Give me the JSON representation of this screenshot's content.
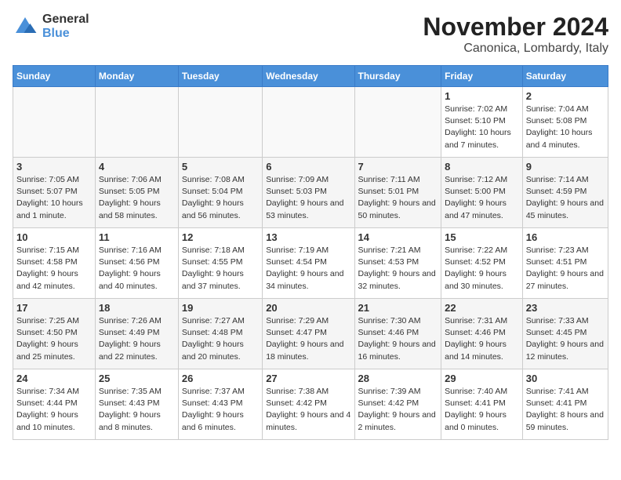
{
  "header": {
    "logo_line1": "General",
    "logo_line2": "Blue",
    "title": "November 2024",
    "subtitle": "Canonica, Lombardy, Italy"
  },
  "calendar": {
    "columns": [
      "Sunday",
      "Monday",
      "Tuesday",
      "Wednesday",
      "Thursday",
      "Friday",
      "Saturday"
    ],
    "weeks": [
      [
        {
          "day": "",
          "info": ""
        },
        {
          "day": "",
          "info": ""
        },
        {
          "day": "",
          "info": ""
        },
        {
          "day": "",
          "info": ""
        },
        {
          "day": "",
          "info": ""
        },
        {
          "day": "1",
          "info": "Sunrise: 7:02 AM\nSunset: 5:10 PM\nDaylight: 10 hours and 7 minutes."
        },
        {
          "day": "2",
          "info": "Sunrise: 7:04 AM\nSunset: 5:08 PM\nDaylight: 10 hours and 4 minutes."
        }
      ],
      [
        {
          "day": "3",
          "info": "Sunrise: 7:05 AM\nSunset: 5:07 PM\nDaylight: 10 hours and 1 minute."
        },
        {
          "day": "4",
          "info": "Sunrise: 7:06 AM\nSunset: 5:05 PM\nDaylight: 9 hours and 58 minutes."
        },
        {
          "day": "5",
          "info": "Sunrise: 7:08 AM\nSunset: 5:04 PM\nDaylight: 9 hours and 56 minutes."
        },
        {
          "day": "6",
          "info": "Sunrise: 7:09 AM\nSunset: 5:03 PM\nDaylight: 9 hours and 53 minutes."
        },
        {
          "day": "7",
          "info": "Sunrise: 7:11 AM\nSunset: 5:01 PM\nDaylight: 9 hours and 50 minutes."
        },
        {
          "day": "8",
          "info": "Sunrise: 7:12 AM\nSunset: 5:00 PM\nDaylight: 9 hours and 47 minutes."
        },
        {
          "day": "9",
          "info": "Sunrise: 7:14 AM\nSunset: 4:59 PM\nDaylight: 9 hours and 45 minutes."
        }
      ],
      [
        {
          "day": "10",
          "info": "Sunrise: 7:15 AM\nSunset: 4:58 PM\nDaylight: 9 hours and 42 minutes."
        },
        {
          "day": "11",
          "info": "Sunrise: 7:16 AM\nSunset: 4:56 PM\nDaylight: 9 hours and 40 minutes."
        },
        {
          "day": "12",
          "info": "Sunrise: 7:18 AM\nSunset: 4:55 PM\nDaylight: 9 hours and 37 minutes."
        },
        {
          "day": "13",
          "info": "Sunrise: 7:19 AM\nSunset: 4:54 PM\nDaylight: 9 hours and 34 minutes."
        },
        {
          "day": "14",
          "info": "Sunrise: 7:21 AM\nSunset: 4:53 PM\nDaylight: 9 hours and 32 minutes."
        },
        {
          "day": "15",
          "info": "Sunrise: 7:22 AM\nSunset: 4:52 PM\nDaylight: 9 hours and 30 minutes."
        },
        {
          "day": "16",
          "info": "Sunrise: 7:23 AM\nSunset: 4:51 PM\nDaylight: 9 hours and 27 minutes."
        }
      ],
      [
        {
          "day": "17",
          "info": "Sunrise: 7:25 AM\nSunset: 4:50 PM\nDaylight: 9 hours and 25 minutes."
        },
        {
          "day": "18",
          "info": "Sunrise: 7:26 AM\nSunset: 4:49 PM\nDaylight: 9 hours and 22 minutes."
        },
        {
          "day": "19",
          "info": "Sunrise: 7:27 AM\nSunset: 4:48 PM\nDaylight: 9 hours and 20 minutes."
        },
        {
          "day": "20",
          "info": "Sunrise: 7:29 AM\nSunset: 4:47 PM\nDaylight: 9 hours and 18 minutes."
        },
        {
          "day": "21",
          "info": "Sunrise: 7:30 AM\nSunset: 4:46 PM\nDaylight: 9 hours and 16 minutes."
        },
        {
          "day": "22",
          "info": "Sunrise: 7:31 AM\nSunset: 4:46 PM\nDaylight: 9 hours and 14 minutes."
        },
        {
          "day": "23",
          "info": "Sunrise: 7:33 AM\nSunset: 4:45 PM\nDaylight: 9 hours and 12 minutes."
        }
      ],
      [
        {
          "day": "24",
          "info": "Sunrise: 7:34 AM\nSunset: 4:44 PM\nDaylight: 9 hours and 10 minutes."
        },
        {
          "day": "25",
          "info": "Sunrise: 7:35 AM\nSunset: 4:43 PM\nDaylight: 9 hours and 8 minutes."
        },
        {
          "day": "26",
          "info": "Sunrise: 7:37 AM\nSunset: 4:43 PM\nDaylight: 9 hours and 6 minutes."
        },
        {
          "day": "27",
          "info": "Sunrise: 7:38 AM\nSunset: 4:42 PM\nDaylight: 9 hours and 4 minutes."
        },
        {
          "day": "28",
          "info": "Sunrise: 7:39 AM\nSunset: 4:42 PM\nDaylight: 9 hours and 2 minutes."
        },
        {
          "day": "29",
          "info": "Sunrise: 7:40 AM\nSunset: 4:41 PM\nDaylight: 9 hours and 0 minutes."
        },
        {
          "day": "30",
          "info": "Sunrise: 7:41 AM\nSunset: 4:41 PM\nDaylight: 8 hours and 59 minutes."
        }
      ]
    ]
  }
}
